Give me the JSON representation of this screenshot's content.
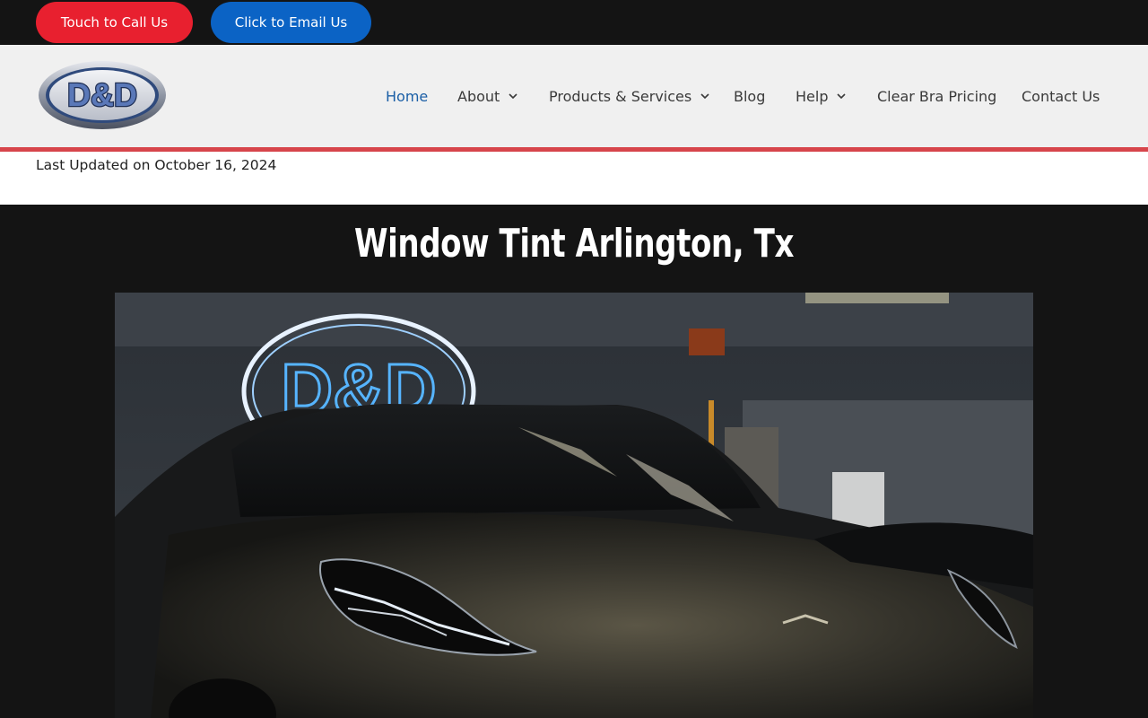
{
  "topbar": {
    "call_label": "Touch to Call Us",
    "email_label": "Click to Email Us",
    "call_color": "#e8202f",
    "email_color": "#0b63c5"
  },
  "logo": {
    "text": "D&D"
  },
  "nav": {
    "items": [
      {
        "label": "Home",
        "active": true,
        "dropdown": false
      },
      {
        "label": "About",
        "active": false,
        "dropdown": true
      },
      {
        "label": "Products & Services",
        "active": false,
        "dropdown": true
      },
      {
        "label": "Blog",
        "active": false,
        "dropdown": false
      },
      {
        "label": "Help",
        "active": false,
        "dropdown": true
      },
      {
        "label": "Clear Bra Pricing",
        "active": false,
        "dropdown": false
      },
      {
        "label": "Contact Us",
        "active": false,
        "dropdown": false
      }
    ],
    "active_color": "#1b5fa6"
  },
  "page": {
    "updated": "Last Updated on October 16, 2024",
    "title": "Window Tint Arlington, Tx"
  },
  "hero": {
    "sign_text": "D&D"
  },
  "colors": {
    "accent_line": "#d7454b",
    "dark_bg": "#141414"
  }
}
